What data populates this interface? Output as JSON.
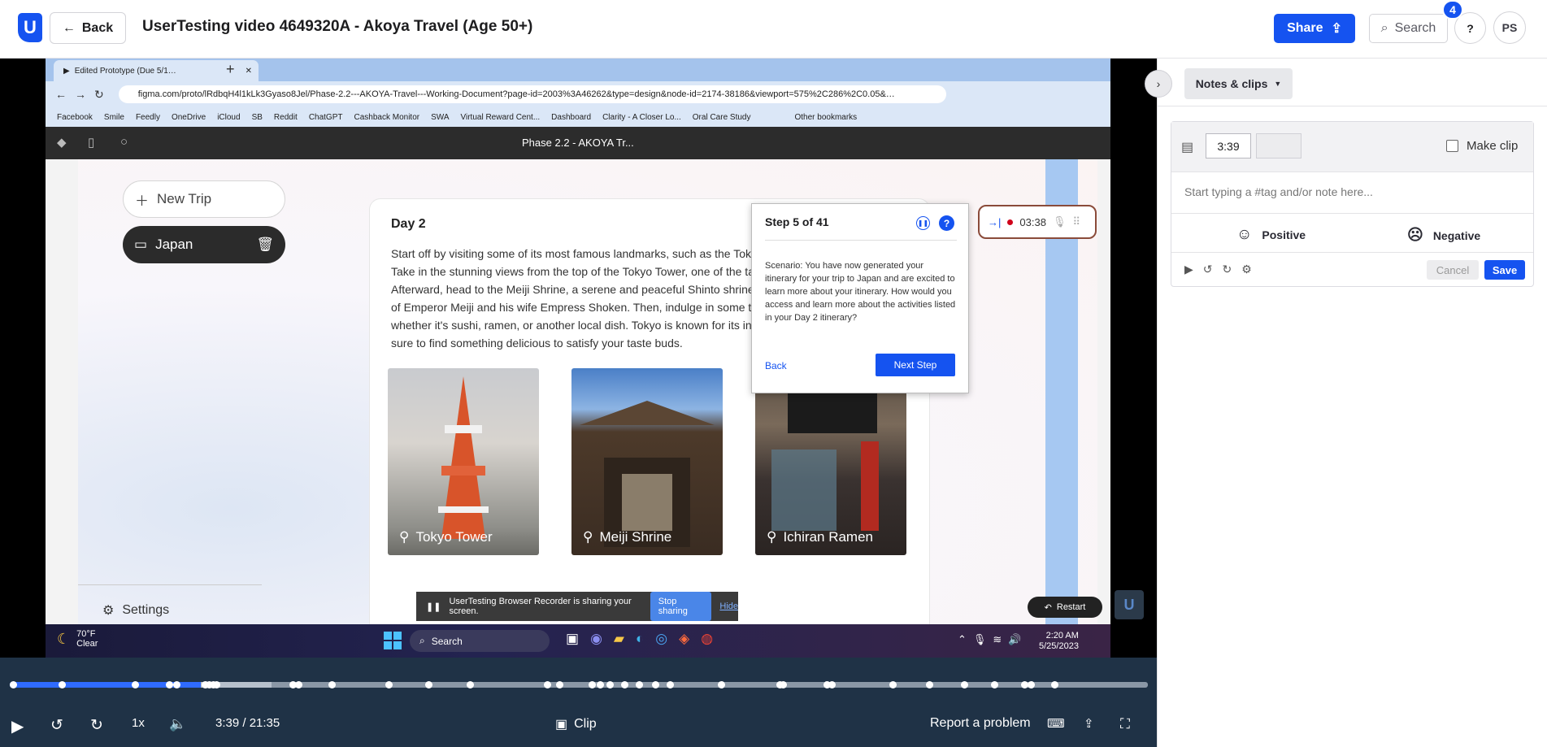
{
  "header": {
    "logo": "U",
    "back_label": "Back",
    "title": "UserTesting video 4649320A - Akoya Travel (Age 50+)",
    "share_label": "Share",
    "search_label": "Search",
    "help_label": "?",
    "notification_count": "4",
    "avatar_initials": "PS"
  },
  "browser": {
    "tab_title": "Edited Prototype (Due 5/1…",
    "url": "figma.com/proto/lRdbqH4l1kLk3Gyaso8Jel/Phase-2.2---AKOYA-Travel---Working-Document?page-id=2003%3A46262&type=design&node-id=2174-38186&viewport=575%2C286%2C0.05&…",
    "bookmarks": [
      "Facebook",
      "Smile",
      "Feedly",
      "OneDrive",
      "iCloud",
      "SB",
      "Reddit",
      "ChatGPT",
      "Cashback Monitor",
      "SWA",
      "Virtual Reward Cent...",
      "Dashboard",
      "Clarity - A Closer Lo...",
      "Oral Care Study",
      "Other bookmarks"
    ],
    "figma_title": "Phase 2.2 - AKOYA Tr..."
  },
  "prototype": {
    "new_trip": "New Trip",
    "trip_name": "Japan",
    "settings": "Settings",
    "day_title": "Day 2",
    "day_text": "Start off by visiting some of its most famous landmarks, such as the Tokyo Tower and the Meiji Shrine. Take in the stunning views from the top of the Tokyo Tower, one of the tallest towers in the world. Afterward, head to the Meiji Shrine, a serene and peaceful Shinto shrine dedicated to the deified spirits of Emperor Meiji and his wife Empress Shoken. Then, indulge in some traditional Japanese cuisine, whether it's sushi, ramen, or another local dish. Tokyo is known for its incredible food scene, so you're sure to find something delicious to satisfy your taste buds.",
    "places": [
      "Tokyo Tower",
      "Meiji Shrine",
      "Ichiran Ramen"
    ]
  },
  "step_popup": {
    "step": "Step 5 of 41",
    "scenario": "Scenario: You have now generated your itinerary for your trip to Japan and are excited to learn more about your itinerary. How would you access and learn more about the activities listed in your Day 2 itinerary?",
    "back": "Back",
    "next": "Next Step"
  },
  "recorder": {
    "elapsed": "03:38",
    "sharing_text": "UserTesting Browser Recorder is sharing your screen.",
    "stop_sharing": "Stop sharing",
    "hide": "Hide",
    "restart": "Restart"
  },
  "taskbar": {
    "temp": "70°F",
    "condition": "Clear",
    "search": "Search",
    "time": "2:20 AM",
    "date": "5/25/2023"
  },
  "player": {
    "progress": 0.17,
    "speed": "1x",
    "time": "3:39 / 21:35",
    "clip_label": "Clip",
    "report_label": "Report a problem"
  },
  "notes": {
    "tab_label": "Notes & clips",
    "time_value": "3:39",
    "make_clip": "Make clip",
    "placeholder": "Start typing a #tag and/or note here...",
    "positive": "Positive",
    "negative": "Negative",
    "cancel": "Cancel",
    "save": "Save"
  },
  "colors": {
    "brand": "#1553f0",
    "player_bg": "#1f3246"
  }
}
